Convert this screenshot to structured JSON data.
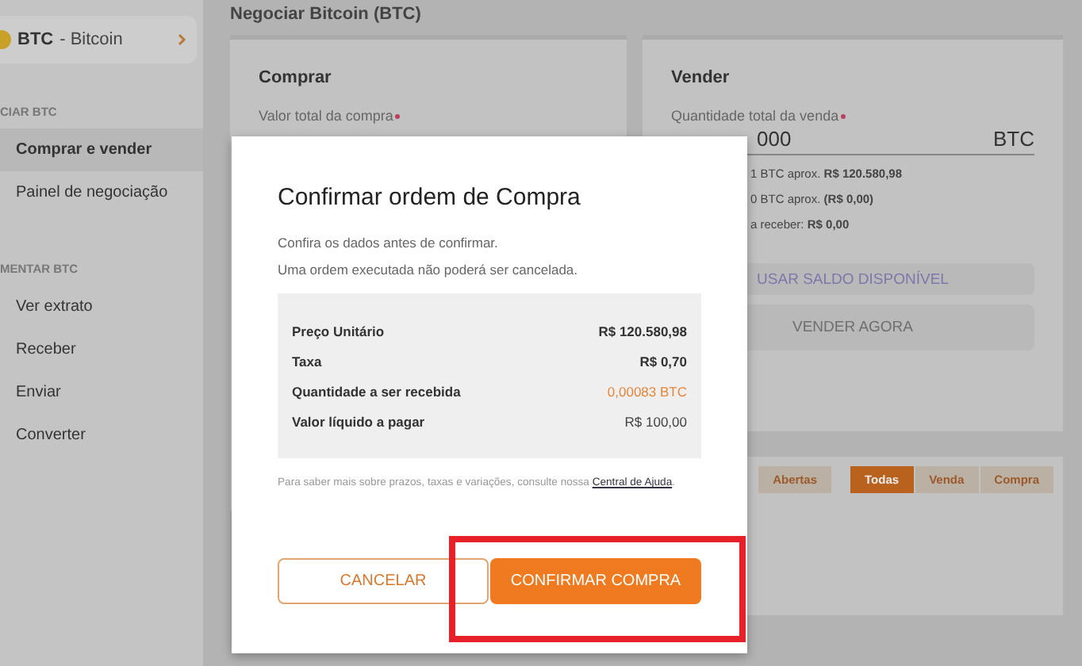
{
  "header": {
    "title": "Negociar Bitcoin (BTC)"
  },
  "sidebar": {
    "coin": {
      "symbol": "BTC",
      "name": "- Bitcoin"
    },
    "sections": [
      {
        "heading": "CIAR BTC",
        "items": [
          {
            "label": "Comprar e vender",
            "selected": true
          },
          {
            "label": "Painel de negociação",
            "selected": false
          }
        ]
      },
      {
        "heading": "MENTAR BTC",
        "items": [
          {
            "label": "Ver extrato",
            "selected": false
          },
          {
            "label": "Receber",
            "selected": false
          },
          {
            "label": "Enviar",
            "selected": false
          },
          {
            "label": "Converter",
            "selected": false
          }
        ]
      }
    ]
  },
  "buy_card": {
    "title": "Comprar",
    "field_label": "Valor total da compra"
  },
  "sell_card": {
    "title": "Vender",
    "field_label": "Quantidade total da venda",
    "field_value": "000",
    "unit": "BTC",
    "lines": [
      "1 BTC aprox. **R$ 120.580,98**",
      "0 BTC aprox. **(R$ 0,00)**",
      "a receber: **R$ 0,00**"
    ],
    "buttons": [
      "USAR SALDO DISPONÍVEL",
      "VENDER AGORA"
    ]
  },
  "orders": {
    "status_tabs": [
      {
        "label": "Abertas",
        "selected": false
      }
    ],
    "type_tabs": [
      {
        "label": "Todas",
        "selected": true
      },
      {
        "label": "Venda",
        "selected": false
      },
      {
        "label": "Compra",
        "selected": false
      }
    ]
  },
  "modal": {
    "title": "Confirmar ordem de Compra",
    "lines": [
      "Confira os dados antes de confirmar.",
      "Uma ordem executada não poderá ser cancelada."
    ],
    "summary": [
      {
        "label": "Preço Unitário",
        "value": "R$ 120.580,98",
        "kind": "bold"
      },
      {
        "label": "Taxa",
        "value": "R$ 0,70",
        "kind": "bold"
      },
      {
        "label": "Quantidade a ser recebida",
        "value": "0,00083 BTC",
        "kind": "accent"
      },
      {
        "label": "Valor líquido a pagar",
        "value": "R$ 100,00",
        "kind": "plain"
      }
    ],
    "footnote": "Para saber mais sobre prazos, taxas e variações, consulte nossa",
    "link": "Central de Ajuda",
    "footnote_end": ".",
    "cancel": "CANCELAR",
    "confirm": "CONFIRMAR COMPRA"
  }
}
